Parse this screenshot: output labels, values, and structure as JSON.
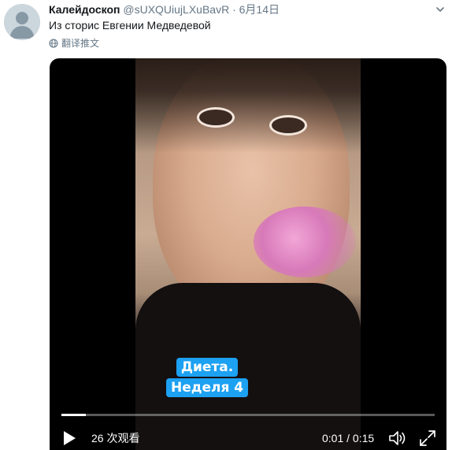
{
  "tweet": {
    "display_name": "Калейдоскоп",
    "handle": "@sUXQUiujLXuBavR",
    "separator": " · ",
    "date": "6月14日",
    "text": "Из сторис Евгении Медведевой",
    "translate_label": "翻译推文"
  },
  "video": {
    "caption_line1": "Диета.",
    "caption_line2": "Неделя 4",
    "views": "26 次观看",
    "time": "0:01 / 0:15",
    "progress": 0.066
  },
  "colors": {
    "accent": "#1da1f2",
    "secondary_text": "#657786",
    "primary_text": "#14171a"
  },
  "icons": {
    "caret": "chevron-down-icon",
    "translate": "globe-icon",
    "play": "play-icon",
    "volume": "volume-icon",
    "fullscreen": "fullscreen-icon"
  }
}
